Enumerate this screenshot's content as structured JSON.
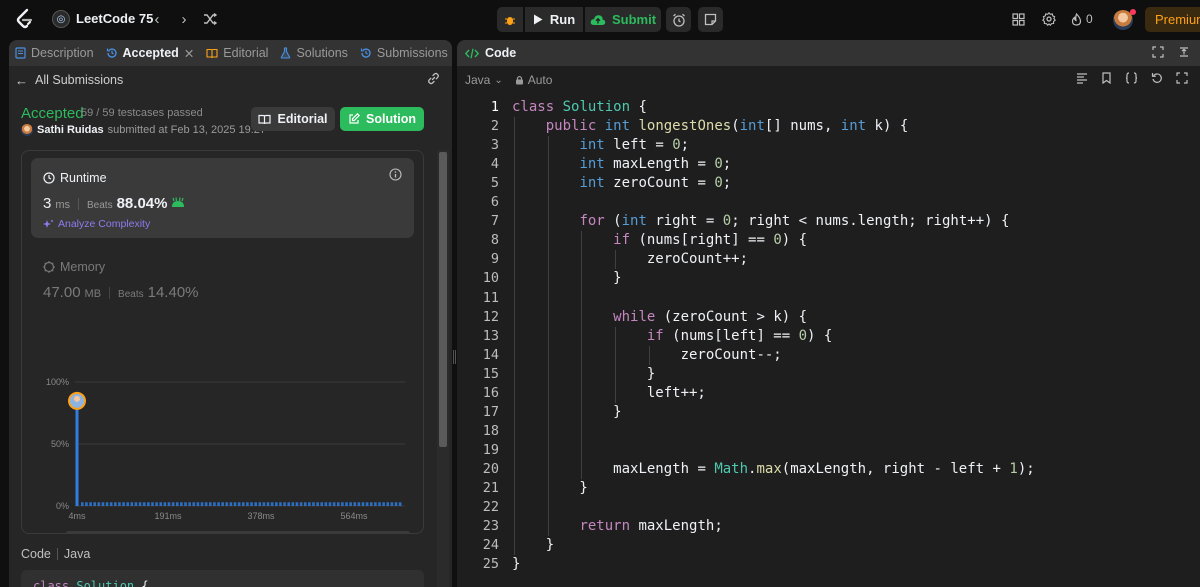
{
  "app": {
    "title": "LeetCode 75",
    "run_label": "Run",
    "submit_label": "Submit",
    "streak_count": "0",
    "premium_label": "Premium"
  },
  "left_tabs": [
    "Description",
    "Accepted",
    "Editorial",
    "Solutions",
    "Submissions"
  ],
  "submission": {
    "back_label": "All Submissions",
    "status": "Accepted",
    "testcases": "59 / 59 testcases passed",
    "user": "Sathi Ruidas",
    "submitted_text": "submitted at Feb 13, 2025 19:27",
    "editorial_btn": "Editorial",
    "solution_btn": "Solution"
  },
  "runtime": {
    "label": "Runtime",
    "value": "3",
    "unit": "ms",
    "beats_label": "Beats",
    "beats_value": "88.04%",
    "analyze_label": "Analyze Complexity"
  },
  "memory": {
    "label": "Memory",
    "value": "47.00",
    "unit": "MB",
    "beats_label": "Beats",
    "beats_value": "14.40%"
  },
  "chart_data": {
    "type": "bar",
    "y_ticks": [
      "100%",
      "50%",
      "0%"
    ],
    "x_ticks": [
      "4ms",
      "191ms",
      "378ms",
      "564ms"
    ],
    "ylim": [
      0,
      100
    ],
    "highlight_bin": "4ms",
    "highlight_value": 88,
    "background_bar_value": 3,
    "colors": {
      "bar": "#2f7de1",
      "grid": "#3a3a3a"
    },
    "brush_ticks": [
      "4ms",
      "191ms",
      "378ms",
      "564ms"
    ]
  },
  "code_footer": {
    "label": "Code",
    "lang": "Java",
    "preview": "class Solution {"
  },
  "editor": {
    "header": "Code",
    "language": "Java",
    "mode": "Auto",
    "lines": [
      "class Solution {",
      "    public int longestOnes(int[] nums, int k) {",
      "        int left = 0;",
      "        int maxLength = 0;",
      "        int zeroCount = 0;",
      "",
      "        for (int right = 0; right < nums.length; right++) {",
      "            if (nums[right] == 0) {",
      "                zeroCount++;",
      "            }",
      "",
      "            while (zeroCount > k) {",
      "                if (nums[left] == 0) {",
      "                    zeroCount--;",
      "                }",
      "                left++;",
      "            }",
      "",
      "",
      "            maxLength = Math.max(maxLength, right - left + 1);",
      "        }",
      "",
      "        return maxLength;",
      "    }",
      "}"
    ]
  }
}
